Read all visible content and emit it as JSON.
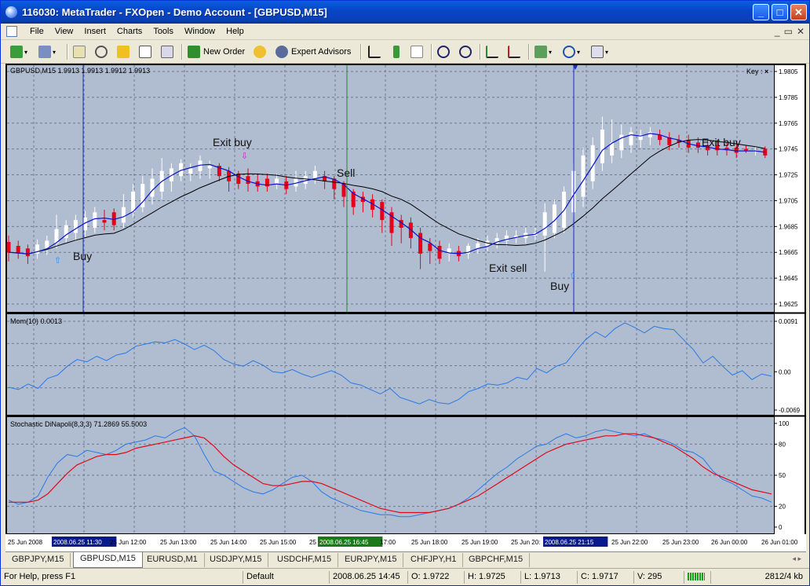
{
  "window": {
    "title": "116030: MetaTrader - FXOpen - Demo Account - [GBPUSD,M15]",
    "controls": [
      "_",
      "□",
      "✕"
    ]
  },
  "menu": {
    "items": [
      "File",
      "View",
      "Insert",
      "Charts",
      "Tools",
      "Window",
      "Help"
    ],
    "mdi_controls": [
      "_",
      "▭",
      "✕"
    ]
  },
  "toolbar": {
    "new_order_label": "New Order",
    "expert_advisors_label": "Expert Advisors"
  },
  "chart": {
    "main_header": "GBPUSD,M15  1.9913  1.9913  1.9912  1.9913",
    "key_label": "Key :",
    "price_ticks": [
      "1.9805",
      "1.9785",
      "1.9765",
      "1.9745",
      "1.9725",
      "1.9705",
      "1.9685",
      "1.9665",
      "1.9645",
      "1.9625"
    ],
    "annotations": [
      {
        "text": "Buy",
        "arrow": "up"
      },
      {
        "text": "Exit buy",
        "arrow": "down"
      },
      {
        "text": "Sell",
        "arrow": ""
      },
      {
        "text": "Exit sell",
        "arrow": ""
      },
      {
        "text": "Buy",
        "arrow": "up"
      },
      {
        "text": "Exit buy",
        "arrow": ""
      }
    ],
    "mom_header": "Mom(10) 0.0013",
    "mom_ticks": [
      "0.0091",
      "0.00",
      "-0.0069"
    ],
    "stoch_header": "Stochastic DiNapoli(8,3,3) 71.2869 55.5003",
    "stoch_ticks": [
      "100",
      "80",
      "50",
      "20",
      "0"
    ],
    "time_labels": [
      "25 Jun 2008",
      "2008.06.25 11:30",
      "25 Jun 12:00",
      "25 Jun 13:00",
      "25 Jun 14:00",
      "25 Jun 15:00",
      "25 Jun 1",
      "2008.06.25 16:45",
      "17:00",
      "25 Jun 18:00",
      "25 Jun 19:00",
      "25 Jun 20:",
      "2008.06.25 21:15",
      "25 Jun 22:00",
      "25 Jun 23:00",
      "26 Jun 00:00",
      "26 Jun 01:00"
    ],
    "colors": {
      "background": "#b0bcd0",
      "grid": "#6d7a90",
      "bull_candle": "#ffffff",
      "bear_candle": "#e8001a",
      "ma_fast": "#0a14c8",
      "ma_slow": "#000000",
      "mom_line": "#2a7ae6",
      "stoch_main": "#2a7ae6",
      "stoch_signal": "#e00a1a",
      "vline_blue": "#1a2acd",
      "vline_green": "#1e8a28"
    }
  },
  "tabs": [
    "GBPJPY,M15",
    "GBPUSD,M15",
    "EURUSD,M1",
    "USDJPY,M15",
    "USDCHF,M15",
    "EURJPY,M15",
    "CHFJPY,H1",
    "GBPCHF,M15"
  ],
  "active_tab": "GBPUSD,M15",
  "status": {
    "help": "For Help, press F1",
    "profile": "Default",
    "datetime": "2008.06.25 14:45",
    "open": "O: 1.9722",
    "high": "H: 1.9725",
    "low": "L: 1.9713",
    "close": "C: 1.9717",
    "volume": "V: 295",
    "traffic": "2812/4 kb"
  }
}
